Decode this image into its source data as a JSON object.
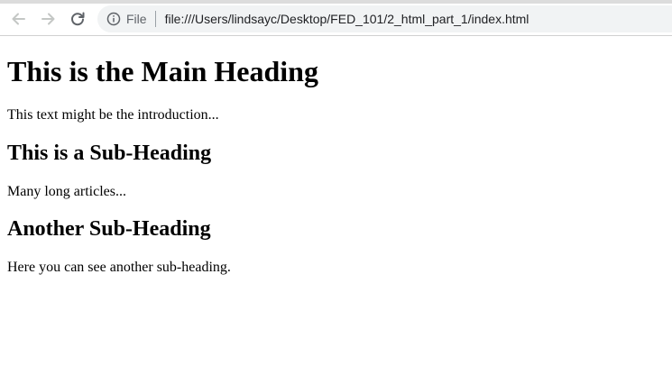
{
  "browser": {
    "omnibox": {
      "scheme_label": "File",
      "url": "file:///Users/lindsayc/Desktop/FED_101/2_html_part_1/index.html"
    },
    "icons": {
      "back": "arrow-left-icon",
      "forward": "arrow-right-icon",
      "reload": "reload-icon",
      "info": "info-icon"
    },
    "colors": {
      "omnibox_bg": "#f1f3f4",
      "icon_gray": "#5f6368"
    }
  },
  "page": {
    "main_heading": "This is the Main Heading",
    "intro": "This text might be the introduction...",
    "sections": [
      {
        "heading": "This is a Sub-Heading",
        "text": "Many long articles..."
      },
      {
        "heading": "Another Sub-Heading",
        "text": "Here you can see another sub-heading."
      }
    ]
  }
}
